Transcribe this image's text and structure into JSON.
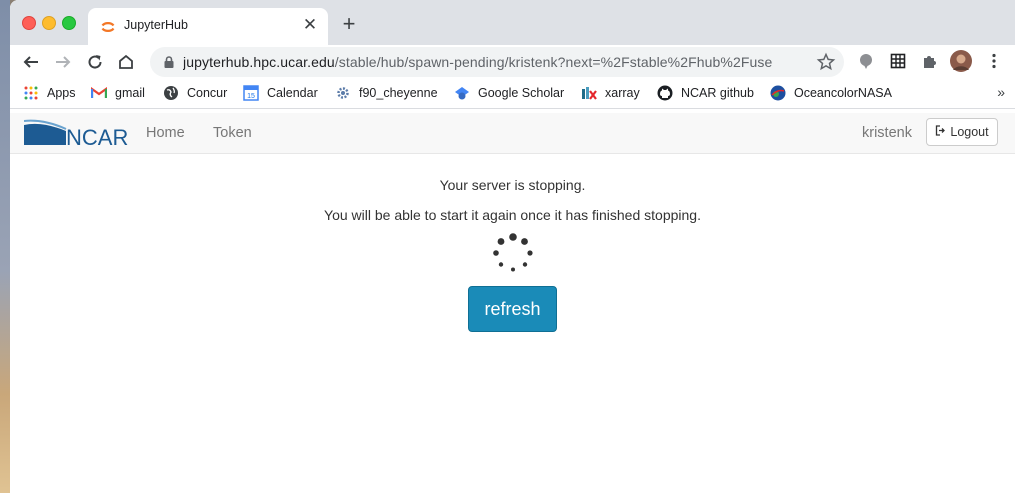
{
  "browser": {
    "tab": {
      "title": "JupyterHub"
    },
    "url": {
      "host": "jupyterhub.hpc.ucar.edu",
      "path": "/stable/hub/spawn-pending/kristenk?next=%2Fstable%2Fhub%2Fuse..."
    },
    "bookmarks": [
      {
        "label": "Apps",
        "icon": "apps-grid-icon"
      },
      {
        "label": "gmail",
        "icon": "gmail-icon"
      },
      {
        "label": "Concur",
        "icon": "globe-icon"
      },
      {
        "label": "Calendar",
        "icon": "calendar-icon"
      },
      {
        "label": "f90_cheyenne",
        "icon": "gear-icon"
      },
      {
        "label": "Google Scholar",
        "icon": "scholar-icon"
      },
      {
        "label": "xarray",
        "icon": "xarray-icon"
      },
      {
        "label": "NCAR github",
        "icon": "github-icon"
      },
      {
        "label": "OceancolorNASA",
        "icon": "nasa-icon"
      }
    ],
    "more_label": "»"
  },
  "hub": {
    "brand": "NCAR",
    "nav": {
      "home": "Home",
      "token": "Token"
    },
    "user": "kristenk",
    "logout_label": "Logout"
  },
  "main": {
    "message1": "Your server is stopping.",
    "message2": "You will be able to start it again once it has finished stopping.",
    "refresh_label": "refresh"
  },
  "colors": {
    "accent": "#1a8bb8",
    "navbar_bg": "#f8f8f8",
    "tabstrip_bg": "#dee1e6"
  }
}
